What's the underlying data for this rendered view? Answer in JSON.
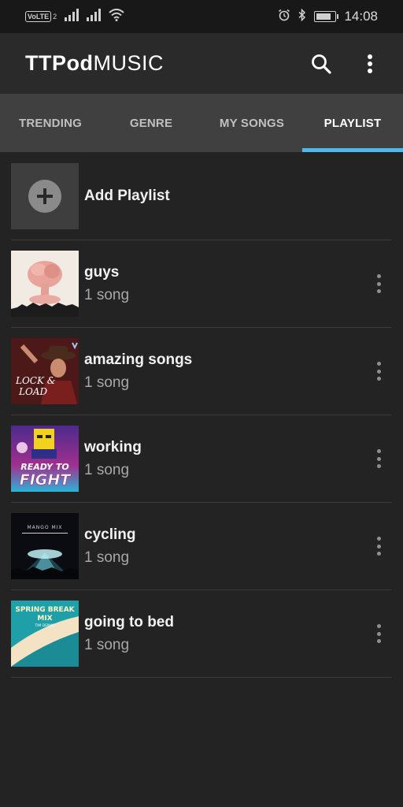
{
  "status_bar": {
    "volte": "VoLTE",
    "sim": "2",
    "time": "14:08",
    "battery_level": 0.8
  },
  "app": {
    "logo_bold": "TTPod",
    "logo_light": "MUSIC",
    "icons": [
      "search-icon",
      "more-vert-icon"
    ]
  },
  "tabs": [
    {
      "label": "TRENDING",
      "active": false
    },
    {
      "label": "GENRE",
      "active": false
    },
    {
      "label": "MY SONGS",
      "active": false
    },
    {
      "label": "PLAYLIST",
      "active": true
    }
  ],
  "accent_color": "#52b8ea",
  "add_playlist": {
    "label": "Add Playlist"
  },
  "playlists": [
    {
      "title": "guys",
      "count": "1 song"
    },
    {
      "title": "amazing songs",
      "count": "1 song"
    },
    {
      "title": "working",
      "count": "1 song"
    },
    {
      "title": "cycling",
      "count": "1 song"
    },
    {
      "title": "going to bed",
      "count": "1 song"
    }
  ],
  "cover_art_text": {
    "amazing_songs_1": "LOCK &",
    "amazing_songs_2": "LOAD",
    "working_1": "READY TO",
    "working_2": "FIGHT",
    "cycling": "MANGO MIX",
    "going_to_bed_1": "SPRING BREAK",
    "going_to_bed_2": "MIX",
    "going_to_bed_3": "TIM DENKO"
  }
}
